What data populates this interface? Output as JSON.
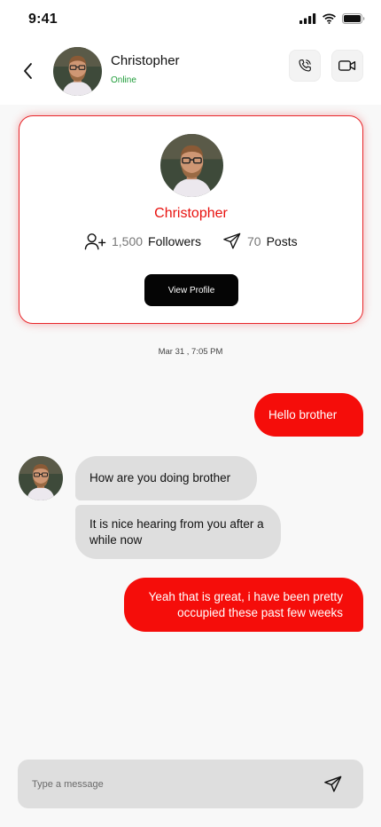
{
  "status_bar": {
    "time": "9:41",
    "icons": [
      "signal-icon",
      "wifi-icon",
      "battery-icon"
    ]
  },
  "header": {
    "name": "Christopher",
    "status": "Online",
    "icons": [
      "back-arrow-icon",
      "phone-icon",
      "video-camera-icon"
    ]
  },
  "profile_card": {
    "name": "Christopher",
    "followers_count": "1,500",
    "followers_label": "Followers",
    "posts_count": "70",
    "posts_label": "Posts",
    "view_profile_label": "View Profile",
    "icons": [
      "add-user-icon",
      "send-icon"
    ]
  },
  "chat": {
    "date": "Mar 31 , 7:05 PM",
    "messages": [
      {
        "direction": "out",
        "text": "Hello brother"
      },
      {
        "direction": "in",
        "text": "How are you doing brother"
      },
      {
        "direction": "in",
        "text": "It is nice hearing from you after a while now"
      },
      {
        "direction": "out",
        "text": "Yeah that is great, i have been pretty occupied these past few weeks"
      }
    ]
  },
  "composer": {
    "placeholder": "Type a message",
    "value": "",
    "icon": "send-icon"
  },
  "colors": {
    "accent": "#f50d0a",
    "online": "#1f9d3a",
    "incoming_bubble": "#dedede",
    "background": "#f8f8f8"
  }
}
